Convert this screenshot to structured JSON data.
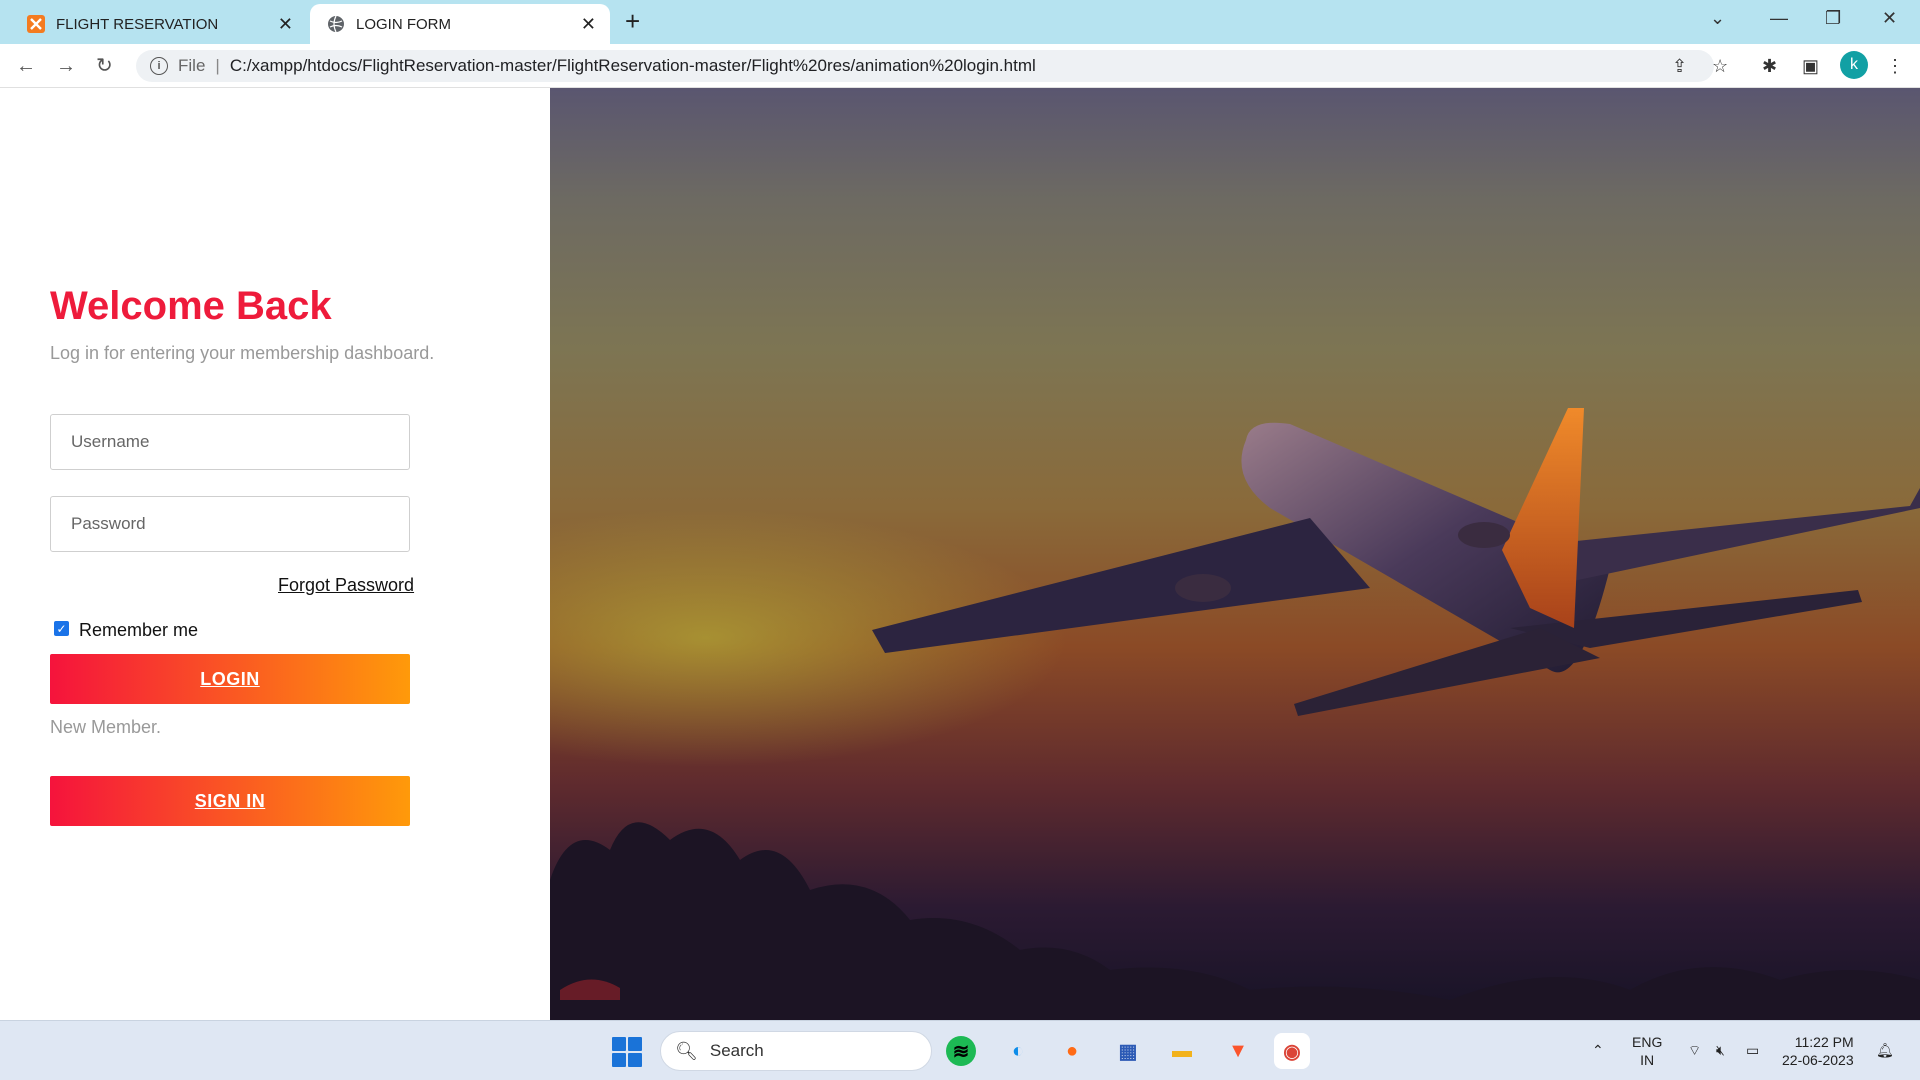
{
  "browser": {
    "tabs": [
      {
        "title": "FLIGHT RESERVATION",
        "icon": "xampp-icon"
      },
      {
        "title": "LOGIN FORM",
        "icon": "globe-icon"
      }
    ],
    "url_prefix": "File",
    "url": "C:/xampp/htdocs/FlightReservation-master/FlightReservation-master/Flight%20res/animation%20login.html",
    "avatar_letter": "k"
  },
  "login": {
    "title": "Welcome Back",
    "subtitle": "Log in for entering your membership dashboard.",
    "username_placeholder": "Username",
    "password_placeholder": "Password",
    "forgot_label": "Forgot Password",
    "remember_label": "Remember me",
    "remember_checked": true,
    "login_label": "LOGIN",
    "new_member_label": "New Member.",
    "signin_label": "SIGN IN",
    "accent_color": "#ee1b3b",
    "gradient": [
      "#f5133c",
      "#ff9a0a"
    ]
  },
  "taskbar": {
    "search_label": "Search",
    "lang_top": "ENG",
    "lang_bottom": "IN",
    "time": "11:22 PM",
    "date": "22-06-2023"
  }
}
